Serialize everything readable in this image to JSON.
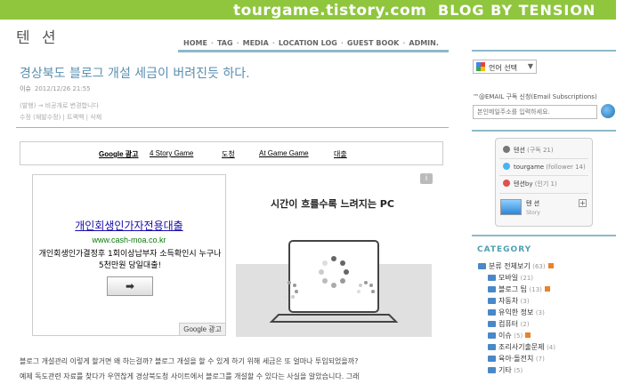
{
  "banner": {
    "url": "tourgame.tistory.com",
    "tagline": "BLOG BY TENSION"
  },
  "site": {
    "title": "텐 션"
  },
  "nav": [
    "HOME",
    "TAG",
    "MEDIA",
    "LOCATION LOG",
    "GUEST BOOK",
    "ADMIN."
  ],
  "post": {
    "title": "경상북도 블로그 개설 세금이 버려진듯 하다.",
    "category": "이슈",
    "date": "2012/12/26 21:55",
    "sub1": "(발행) → 비공개로 변경합니다",
    "sub2": "수정 (재발수정) | 트랙백 | 삭제",
    "body1": "블로그 개설관리 이렇게 할거면 왜 하는걸까? 블로그 개설을 할 수 있게 하기 위해 세금은 또 얼마나 투입되었을까?",
    "body2": "예제 독도관련 자료를 찾다가 우연찮게 경상북도청 사이트에서 블로그를 개설할 수 있다는 사실을 알았습니다. 그래"
  },
  "google_links": {
    "label": "Google 광고",
    "items": [
      "4 Story Game",
      "도청",
      "At Game Game",
      "대출"
    ]
  },
  "ad_left": {
    "headline": "개인회생인가자전용대출",
    "url": "www.cash-moa.co.kr",
    "desc": "개인회생인가결정후 1회이상납부자 소득확인시 누구나 5천만원 당일대출!",
    "button": "➡",
    "badge": "Google 광고"
  },
  "ad_right": {
    "title": "시간이 흐를수록 느려지는 PC"
  },
  "ad_info": "i",
  "sidebar": {
    "language": {
      "label": "언어 선택",
      "arrow": "▼"
    },
    "subscribe": {
      "title": "™@EMAIL 구독 신청(Email Subscriptions)",
      "placeholder": "본인메일주소를 입력하세요."
    },
    "card": {
      "rows": [
        {
          "label": "텐션",
          "count": "(구독 21)"
        },
        {
          "label": "tourgame",
          "count": "(follower 14)"
        },
        {
          "label": "텐션by",
          "count": "(인기 1)"
        }
      ],
      "profile_name": "텐 션",
      "profile_sub": "Story",
      "plus": "+"
    },
    "category_title": "CATEGORY",
    "categories": [
      {
        "name": "분류 전체보기",
        "count": "(63)",
        "new": true
      },
      {
        "name": "모바일",
        "count": "(21)",
        "new": false
      },
      {
        "name": "블로그 팁",
        "count": "(13)",
        "new": true
      },
      {
        "name": "자동차",
        "count": "(3)",
        "new": false
      },
      {
        "name": "유익한 정보",
        "count": "(3)",
        "new": false
      },
      {
        "name": "컴퓨터",
        "count": "(2)",
        "new": false
      },
      {
        "name": "이슈",
        "count": "(5)",
        "new": true
      },
      {
        "name": "조리사기출문제",
        "count": "(4)",
        "new": false
      },
      {
        "name": "육아·돌전치",
        "count": "(7)",
        "new": false
      },
      {
        "name": "기타",
        "count": "(5)",
        "new": false
      }
    ]
  },
  "colors": {
    "banner": "#8fc63e",
    "accent": "#8cb9c9",
    "title": "#5a8fb0"
  }
}
